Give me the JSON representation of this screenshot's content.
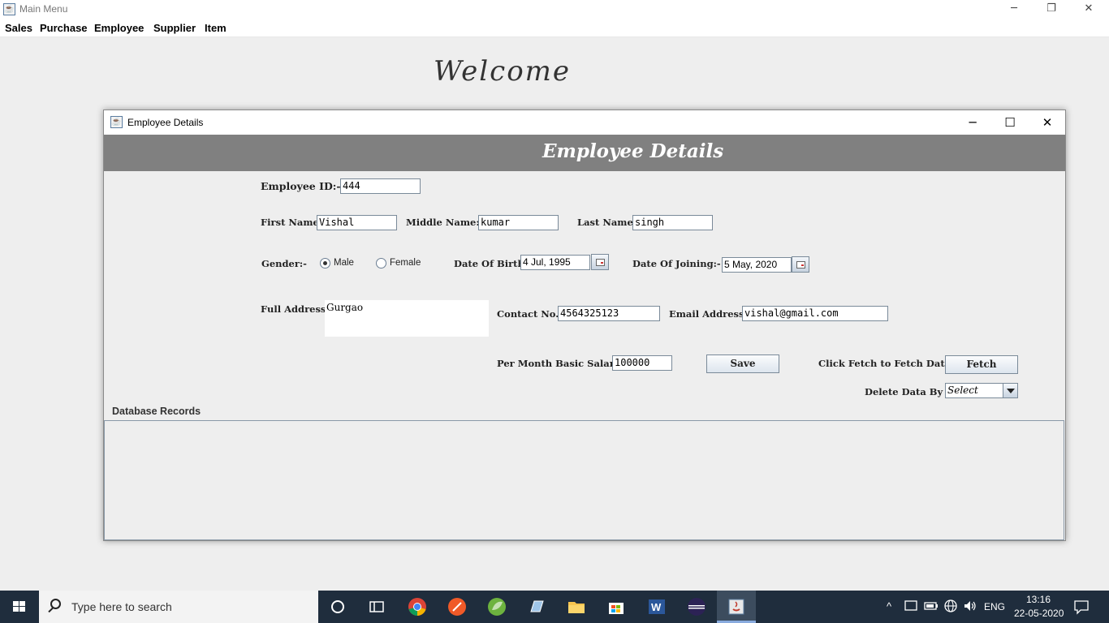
{
  "main_window": {
    "title": "Main Menu",
    "menu": [
      "Sales",
      "Purchase",
      "Employee",
      "Supplier",
      "Item"
    ],
    "welcome": "Welcome"
  },
  "employee_window": {
    "title": "Employee Details",
    "banner": "Employee Details",
    "labels": {
      "employee_id": "Employee ID:-",
      "first_name": "First Name:-",
      "middle_name": "Middle Name:-",
      "last_name": "Last Name:-",
      "gender": "Gender:-",
      "male": "Male",
      "female": "Female",
      "dob": "Date Of Birth:-",
      "doj": "Date Of Joining:-",
      "address": "Full Address:-",
      "contact": "Contact No.:-",
      "email": "Email Address:-",
      "salary": "Per Month Basic Salary:-",
      "fetch_hint": "Click Fetch to Fetch Data:-",
      "delete_by": "Delete Data By",
      "records": "Database Records"
    },
    "values": {
      "employee_id": "444",
      "first_name": "Vishal",
      "middle_name": "kumar",
      "last_name": "singh",
      "gender_selected": "Male",
      "dob": "4 Jul, 1995",
      "doj": "5 May, 2020",
      "address": "Gurgao",
      "contact": "4564325123",
      "email": "vishal@gmail.com",
      "salary": "100000",
      "delete_by": "Select"
    },
    "buttons": {
      "save": "Save",
      "fetch": "Fetch"
    }
  },
  "taskbar": {
    "search_placeholder": "Type here to search",
    "language": "ENG",
    "time": "13:16",
    "date": "22-05-2020",
    "apps": [
      "task-view-icon",
      "widgets-icon",
      "chrome-icon",
      "app-orange-icon",
      "spring-icon",
      "notepad-icon",
      "file-explorer-icon",
      "store-icon",
      "word-icon",
      "eclipse-icon",
      "java-icon"
    ]
  }
}
